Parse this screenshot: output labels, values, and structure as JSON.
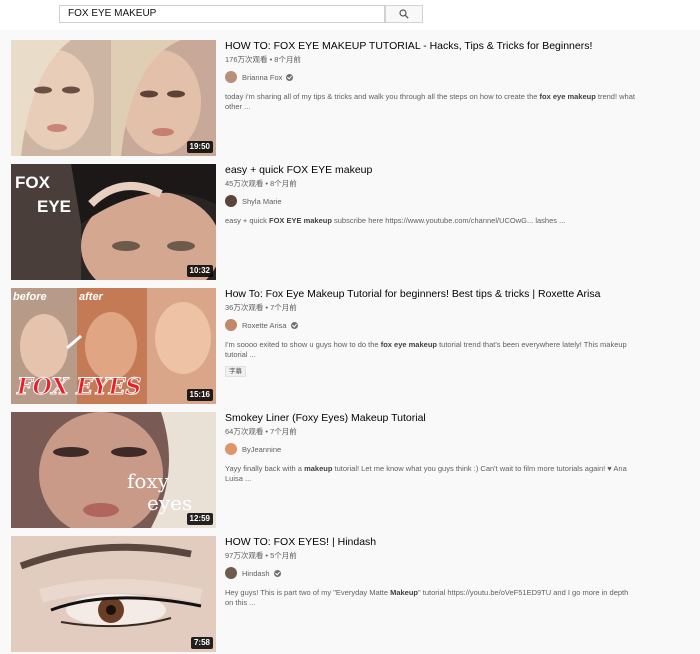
{
  "search": {
    "query": "FOX EYE MAKEUP"
  },
  "icons": {
    "search_button": "search-icon",
    "verified": "verified-check-icon"
  },
  "results": [
    {
      "title": "HOW TO: FOX EYE MAKEUP TUTORIAL - Hacks, Tips & Tricks for Beginners!",
      "meta": "176万次观看 • 8个月前",
      "channel": "Brianna Fox",
      "verified": true,
      "desc_pre": "today i'm sharing all of my tips & tricks and walk you through all the steps on how to create the ",
      "desc_bold": "fox eye makeup",
      "desc_post": " trend! what other ...",
      "duration": "19:50",
      "badge": ""
    },
    {
      "title": "easy + quick FOX EYE makeup",
      "meta": "45万次观看 • 8个月前",
      "channel": "Shyla Marie",
      "verified": false,
      "desc_pre": "easy + quick ",
      "desc_bold": "FOX EYE makeup",
      "desc_post": " subscribe here https://www.youtube.com/channel/UCOwG... lashes ...",
      "duration": "10:32",
      "thumb_text": [
        "FOX",
        "EYE"
      ],
      "badge": ""
    },
    {
      "title": "How To: Fox Eye Makeup Tutorial for beginners! Best tips & tricks | Roxette Arisa",
      "meta": "36万次观看 • 7个月前",
      "channel": "Roxette Arisa",
      "verified": true,
      "desc_pre": "I'm soooo exited to show u guys how to do the ",
      "desc_bold": "fox eye makeup",
      "desc_post": " tutorial trend that's been everywhere lately! This makeup tutorial ...",
      "duration": "15:16",
      "thumb_text": [
        "before",
        "after",
        "FOX EYES"
      ],
      "badge": "字幕"
    },
    {
      "title": "Smokey Liner (Foxy Eyes) Makeup Tutorial",
      "meta": "64万次观看 • 7个月前",
      "channel": "ByJeannine",
      "verified": false,
      "desc_pre": "Yayy finally back with a ",
      "desc_bold": "makeup",
      "desc_post": " tutorial! Let me know what you guys think :) Can't wait to film more tutorials again! ♥ Ana Luisa ...",
      "duration": "12:59",
      "thumb_text": [
        "foxy",
        "eyes"
      ],
      "badge": ""
    },
    {
      "title": "HOW TO: FOX EYES! | Hindash",
      "meta": "97万次观看 • 5个月前",
      "channel": "Hindash",
      "verified": true,
      "desc_pre": "Hey guys! This is part two of my \"Everyday Matte ",
      "desc_bold": "Makeup",
      "desc_post": "\" tutorial https://youtu.be/oVeF51ED9TU and I go more in depth on this ...",
      "duration": "7:58",
      "badge": ""
    }
  ]
}
